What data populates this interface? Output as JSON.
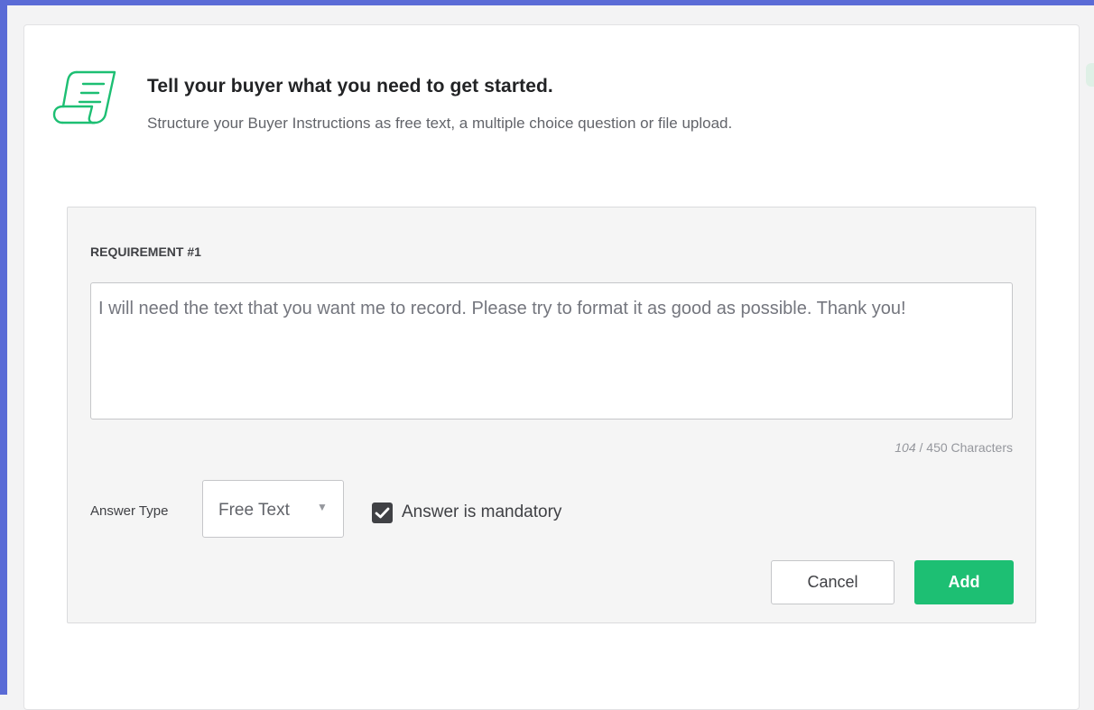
{
  "header": {
    "icon": "scroll-icon",
    "title": "Tell your buyer what you need to get started.",
    "subtitle": "Structure your Buyer Instructions as free text, a multiple choice question or file upload."
  },
  "requirement": {
    "label": "REQUIREMENT #1",
    "text": "I will need the text that you want me to record. Please try to format it as good as possible. Thank you!",
    "char_count_current": "104",
    "char_count_suffix": " / 450 Characters"
  },
  "answer_type": {
    "label": "Answer Type",
    "selected": "Free Text",
    "dropdown_icon": "caret-down-icon"
  },
  "mandatory": {
    "label": "Answer is mandatory",
    "checked": true
  },
  "buttons": {
    "cancel": "Cancel",
    "add": "Add"
  },
  "colors": {
    "accent": "#1dbf73",
    "frame": "#5a6bd6",
    "checkbox": "#404145"
  }
}
